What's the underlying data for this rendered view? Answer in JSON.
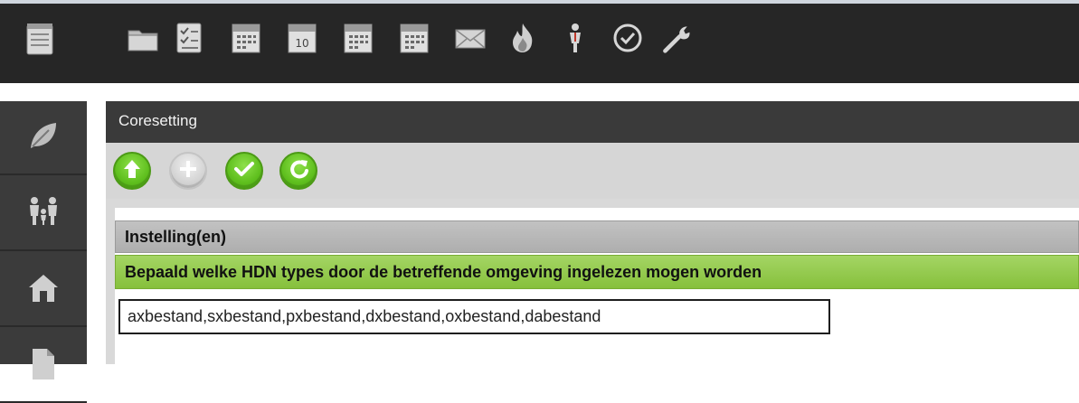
{
  "toolbar": {
    "icons": [
      "notepad-icon",
      "folder-icon",
      "checklist-icon",
      "calendar-icon",
      "calendar-day-icon",
      "calendar-icon",
      "calendar-icon",
      "mail-icon",
      "fire-icon",
      "person-icon",
      "clock-icon",
      "wrench-icon"
    ],
    "calendar_day": "10"
  },
  "sidebar": {
    "icons": [
      "leaf-icon",
      "family-icon",
      "house-icon",
      "document-icon"
    ]
  },
  "panel": {
    "title": "Coresetting",
    "actions": [
      "upload-icon",
      "add-icon",
      "check-icon",
      "refresh-icon"
    ]
  },
  "settings": {
    "header": "Instelling(en)",
    "description": "Bepaald welke HDN types door de betreffende omgeving ingelezen mogen worden",
    "value": "axbestand,sxbestand,pxbestand,dxbestand,oxbestand,dabestand"
  },
  "colors": {
    "toolbar_bg": "#262626",
    "panel_header_bg": "#3a3a3a",
    "accent_green": "#5fbf1e",
    "description_green": "#94c94c"
  }
}
